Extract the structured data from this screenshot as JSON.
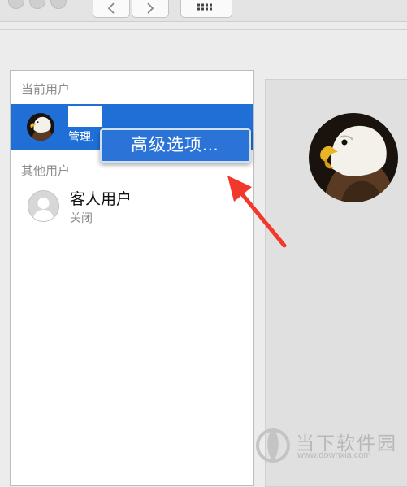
{
  "toolbar": {
    "icons": [
      "back-chevron-icon",
      "forward-chevron-icon",
      "grid-icon"
    ]
  },
  "users_panel": {
    "current_users_header": "当前用户",
    "other_users_header": "其他用户",
    "current_user": {
      "role": "管理.",
      "avatar": "eagle-avatar"
    },
    "guest_user": {
      "name": "客人用户",
      "status": "关闭",
      "avatar": "generic-user-icon"
    }
  },
  "context_menu": {
    "items": [
      {
        "label": "高级选项..."
      }
    ]
  },
  "annotation": {
    "arrow_color": "#f2372b"
  },
  "watermark": {
    "name": "当下软件园",
    "url": "www.downxia.com"
  },
  "colors": {
    "selection": "#1f6fd6",
    "menu_highlight": "#2b73d6",
    "arrow": "#f2372b"
  }
}
